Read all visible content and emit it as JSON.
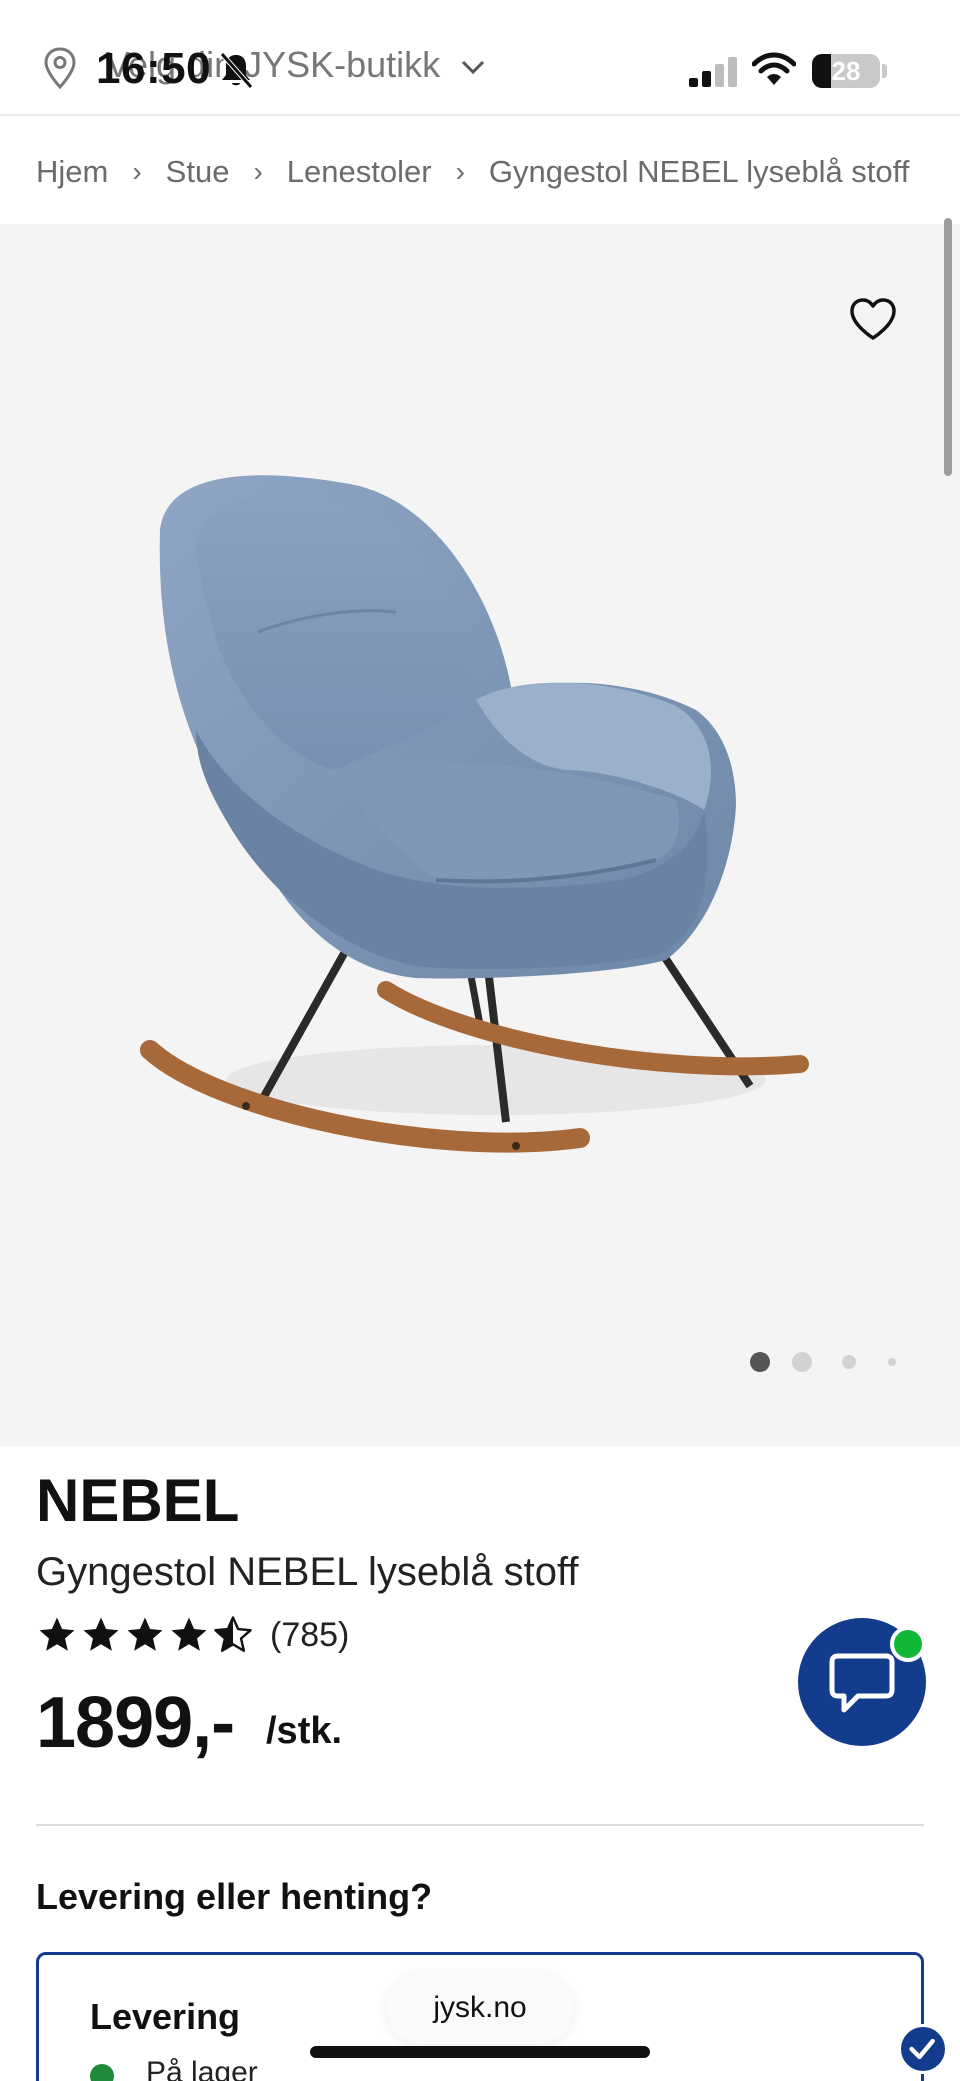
{
  "status_bar": {
    "time": "16:50",
    "battery": "28"
  },
  "store_selector": {
    "label": "Velg din JYSK-butikk"
  },
  "breadcrumb": [
    "Hjem",
    "Stue",
    "Lenestoler",
    "Gyngestol NEBEL lyseblå stoff"
  ],
  "gallery": {
    "image_count": 4,
    "active_index": 0
  },
  "product": {
    "brand": "NEBEL",
    "name": "Gyngestol NEBEL lyseblå stoff",
    "rating": 4.5,
    "reviews": "(785)",
    "price": "1899,-",
    "unit": "/stk."
  },
  "delivery": {
    "question": "Levering eller henting?",
    "option_title": "Levering",
    "stock_status": "På lager"
  },
  "browser": {
    "url": "jysk.no"
  },
  "colors": {
    "brand_blue": "#143c8c",
    "online_green": "#11b836",
    "stock_green": "#1f8a3a",
    "gallery_bg": "#f4f4f4"
  }
}
